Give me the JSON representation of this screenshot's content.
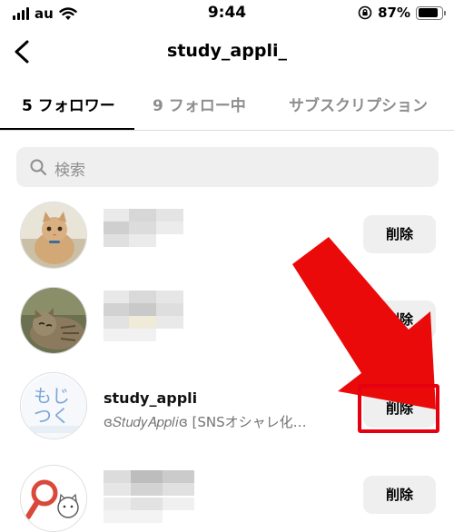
{
  "status_bar": {
    "carrier": "au",
    "time": "9:44",
    "battery_percent": "87%",
    "battery_level": 0.87
  },
  "header": {
    "title": "study_appli_"
  },
  "tabs": [
    {
      "label": "5 フォロワー",
      "active": true
    },
    {
      "label": "9 フォロー中",
      "active": false
    },
    {
      "label": "サブスクリプション",
      "active": false
    }
  ],
  "search": {
    "placeholder": "検索"
  },
  "followers": [
    {
      "username": "",
      "subtitle": "",
      "button": "削除",
      "avatar": "cat-avatar"
    },
    {
      "username": "",
      "subtitle": "",
      "button": "削除",
      "avatar": "tabby-cat-avatar"
    },
    {
      "username": "study_appli",
      "subtitle": "ɞ𝑆𝑡𝑢𝑑𝑦𝐴𝑝𝑝𝑙𝑖ɞ [SNSオシャレ化…",
      "button": "削除",
      "avatar": "moji-tsuku-avatar"
    },
    {
      "username": "",
      "subtitle": "",
      "button": "削除",
      "avatar": "magnifier-cat-avatar"
    }
  ],
  "colors": {
    "highlight": "#e6000f",
    "button_bg": "#efefef",
    "muted_text": "#8e8e8e"
  }
}
